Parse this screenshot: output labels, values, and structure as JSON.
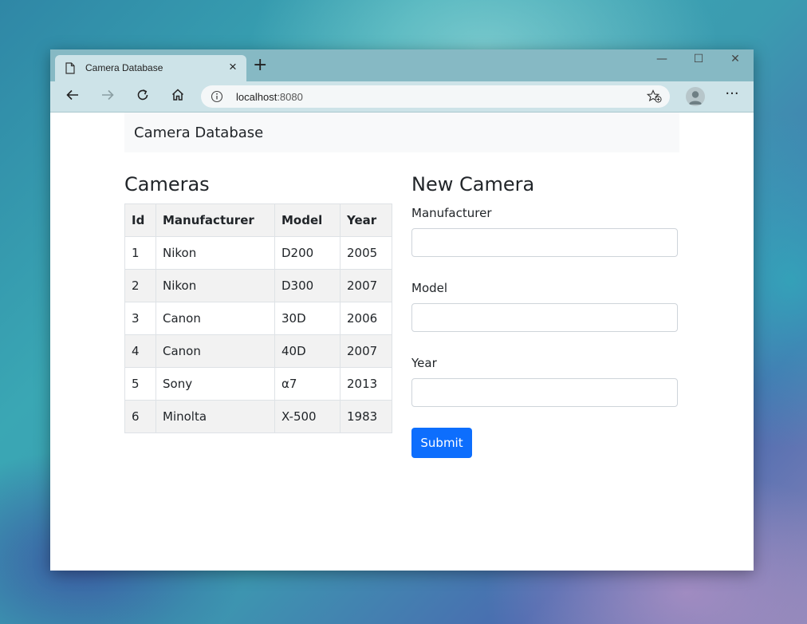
{
  "browser": {
    "tab_title": "Camera Database",
    "tab_close": "×",
    "new_tab": "+",
    "url_host": "localhost",
    "url_port": ":8080",
    "more": "···",
    "window_controls": {
      "minimize": "—",
      "maximize": "☐",
      "close": "✕"
    }
  },
  "navbar": {
    "brand": "Camera Database"
  },
  "cameras": {
    "title": "Cameras",
    "columns": [
      "Id",
      "Manufacturer",
      "Model",
      "Year"
    ],
    "rows": [
      [
        "1",
        "Nikon",
        "D200",
        "2005"
      ],
      [
        "2",
        "Nikon",
        "D300",
        "2007"
      ],
      [
        "3",
        "Canon",
        "30D",
        "2006"
      ],
      [
        "4",
        "Canon",
        "40D",
        "2007"
      ],
      [
        "5",
        "Sony",
        "α7",
        "2013"
      ],
      [
        "6",
        "Minolta",
        "X-500",
        "1983"
      ]
    ]
  },
  "form": {
    "title": "New Camera",
    "manufacturer_label": "Manufacturer",
    "manufacturer_value": "",
    "model_label": "Model",
    "model_value": "",
    "year_label": "Year",
    "year_value": "",
    "submit_label": "Submit"
  },
  "colors": {
    "primary": "#0d6efd",
    "navbar_bg": "#f8f9fa",
    "stripe": "#f2f2f2",
    "titlebar": "#86b9c4",
    "toolbar": "#cde3e8"
  }
}
